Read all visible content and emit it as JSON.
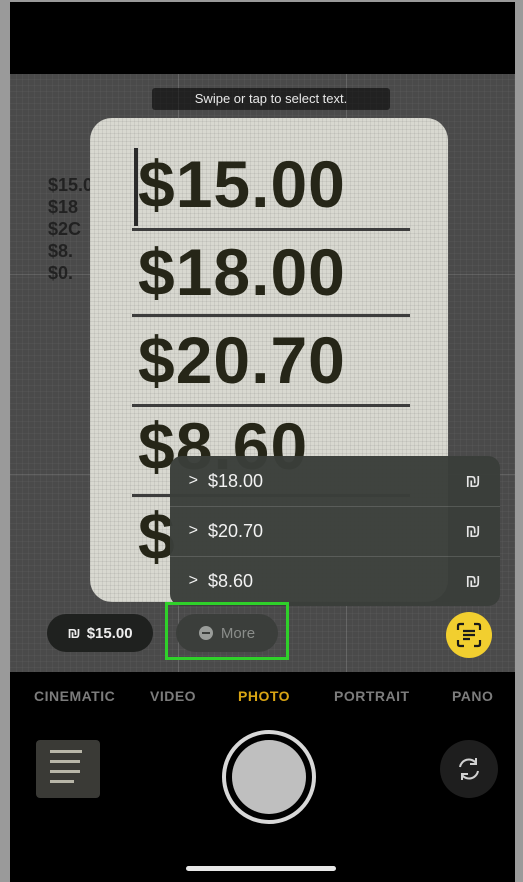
{
  "camera": {
    "hint_text": "Swipe or tap to select text.",
    "background_prices": [
      "$15.00",
      "$18",
      "$2C",
      "$8.",
      "$0."
    ],
    "paper_prices": [
      "$15.00",
      "$18.00",
      "$20.70",
      "$8.60",
      "$"
    ],
    "selected_chip_price": "$15.00",
    "more_label": "More"
  },
  "menu": {
    "items": [
      {
        "value": "$18.00",
        "chevron": ">"
      },
      {
        "value": "$20.70",
        "chevron": ">"
      },
      {
        "value": "$8.60",
        "chevron": ">"
      }
    ]
  },
  "modes": {
    "items": [
      "CINEMATIC",
      "VIDEO",
      "PHOTO",
      "PORTRAIT",
      "PANO"
    ],
    "active": "PHOTO"
  },
  "colors": {
    "active_mode": "#d9a514",
    "highlight": "#2fd12a",
    "live_text_button": "#f2cf2f"
  },
  "icons": {
    "conversion": "currency-convert-icon",
    "more": "more-icon",
    "live_text": "live-text-icon",
    "flip": "flip-camera-icon"
  }
}
